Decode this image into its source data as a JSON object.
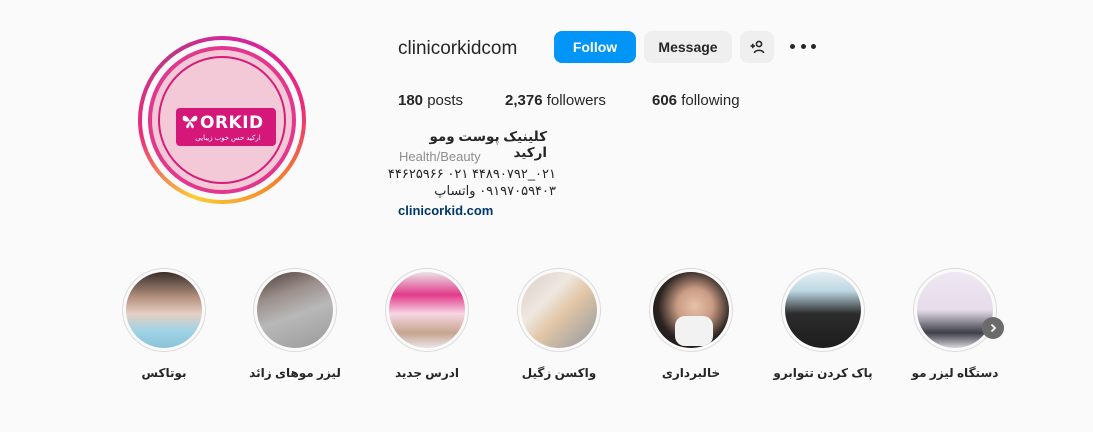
{
  "profile": {
    "username": "clinicorkidcom",
    "follow_label": "Follow",
    "message_label": "Message",
    "logo_title": "ORKID",
    "logo_subtitle": "ارکید حس خوب زیبایی"
  },
  "stats": {
    "posts_count": "180",
    "posts_label": "posts",
    "followers_count": "2,376",
    "followers_label": "followers",
    "following_count": "606",
    "following_label": "following"
  },
  "bio": {
    "name": "کلینیک پوست ومو ارکید",
    "category": "Health/Beauty",
    "line1": "۰۲۱_۴۴۸۹۰۷۹۲ ۰۲۱ ۴۴۶۲۵۹۶۶",
    "line2": "۰۹۱۹۷۰۵۹۴۰۳  واتساپ",
    "link": "clinicorkid.com"
  },
  "highlights": [
    {
      "label": "دستگاه لیزر مو"
    },
    {
      "label": "پاک کردن تتوابرو"
    },
    {
      "label": "خالبرداری"
    },
    {
      "label": "واکسن زگیل"
    },
    {
      "label": "ادرس جدید"
    },
    {
      "label": "لیزر موهای زائد"
    },
    {
      "label": "بوتاکس"
    }
  ],
  "colors": {
    "accent": "#0095f6",
    "brand_pink": "#d6177a",
    "link": "#00376b"
  },
  "icons": [
    "add-person-icon",
    "more-options-icon",
    "chevron-right-icon",
    "butterfly-icon"
  ]
}
